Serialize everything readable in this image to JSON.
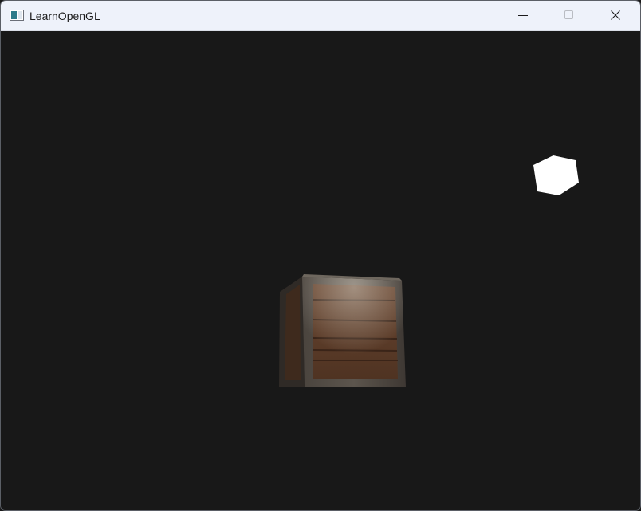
{
  "window": {
    "title": "LearnOpenGL",
    "icon": "application-window-icon",
    "controls": [
      "minimize-icon",
      "maximize-icon",
      "close-icon"
    ]
  },
  "scene": {
    "background_color": "#181818",
    "light_cube_color": "#ffffff",
    "crate_wood_color": "#5a3a26",
    "crate_frame_color": "#3d3833"
  }
}
